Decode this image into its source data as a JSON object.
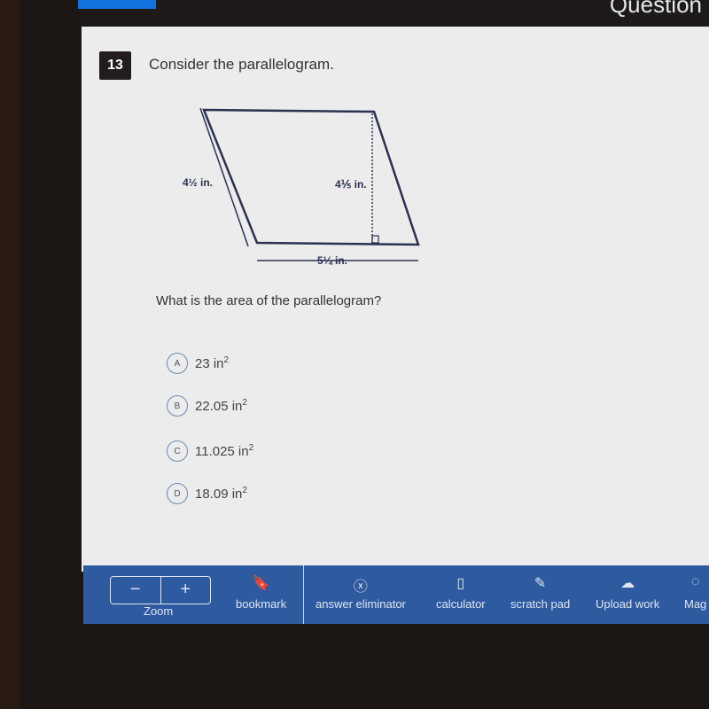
{
  "header": {
    "title": "Question"
  },
  "question": {
    "number": "13",
    "intro": "Consider the parallelogram.",
    "prompt": "What is the area of the parallelogram?",
    "figure": {
      "side_label": "4½ in.",
      "height_label": "4⅕ in.",
      "base_label": "5¼ in."
    },
    "choices": [
      {
        "letter": "A",
        "text": "23 in",
        "sup": "2"
      },
      {
        "letter": "B",
        "text": "22.05 in",
        "sup": "2"
      },
      {
        "letter": "C",
        "text": "11.025 in",
        "sup": "2"
      },
      {
        "letter": "D",
        "text": "18.09 in",
        "sup": "2"
      }
    ]
  },
  "toolbar": {
    "zoom_label": "Zoom",
    "zoom_out": "−",
    "zoom_in": "+",
    "tools": [
      {
        "label": "bookmark",
        "icon": "🔖"
      },
      {
        "label": "answer eliminator",
        "icon": "ⓧ"
      },
      {
        "label": "calculator",
        "icon": "▯"
      },
      {
        "label": "scratch pad",
        "icon": "✎"
      },
      {
        "label": "Upload work",
        "icon": "☁"
      },
      {
        "label": "Mag",
        "icon": "◌"
      }
    ]
  },
  "colors": {
    "toolbar": "#2e5aa0",
    "accent": "#1273de"
  }
}
